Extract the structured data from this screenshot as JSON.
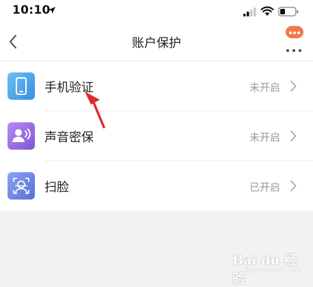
{
  "status_bar": {
    "time": "10:10"
  },
  "nav": {
    "title": "账户保护"
  },
  "items": [
    {
      "label": "手机验证",
      "status": "未开启",
      "icon": "phone-icon",
      "color_from": "#60b4f0",
      "color_to": "#3a8ee0"
    },
    {
      "label": "声音密保",
      "status": "未开启",
      "icon": "voice-user-icon",
      "color_from": "#a47be8",
      "color_to": "#7d55d8"
    },
    {
      "label": "扫脸",
      "status": "已开启",
      "icon": "face-scan-icon",
      "color_from": "#7c94f0",
      "color_to": "#5a6fd8"
    }
  ],
  "watermark": {
    "main": "Bai du 经验",
    "sub": "jingyan.baidu.com"
  },
  "colors": {
    "accent_orange": "#f2784b",
    "arrow_red": "#e02a2a",
    "status_gray": "#999999"
  }
}
